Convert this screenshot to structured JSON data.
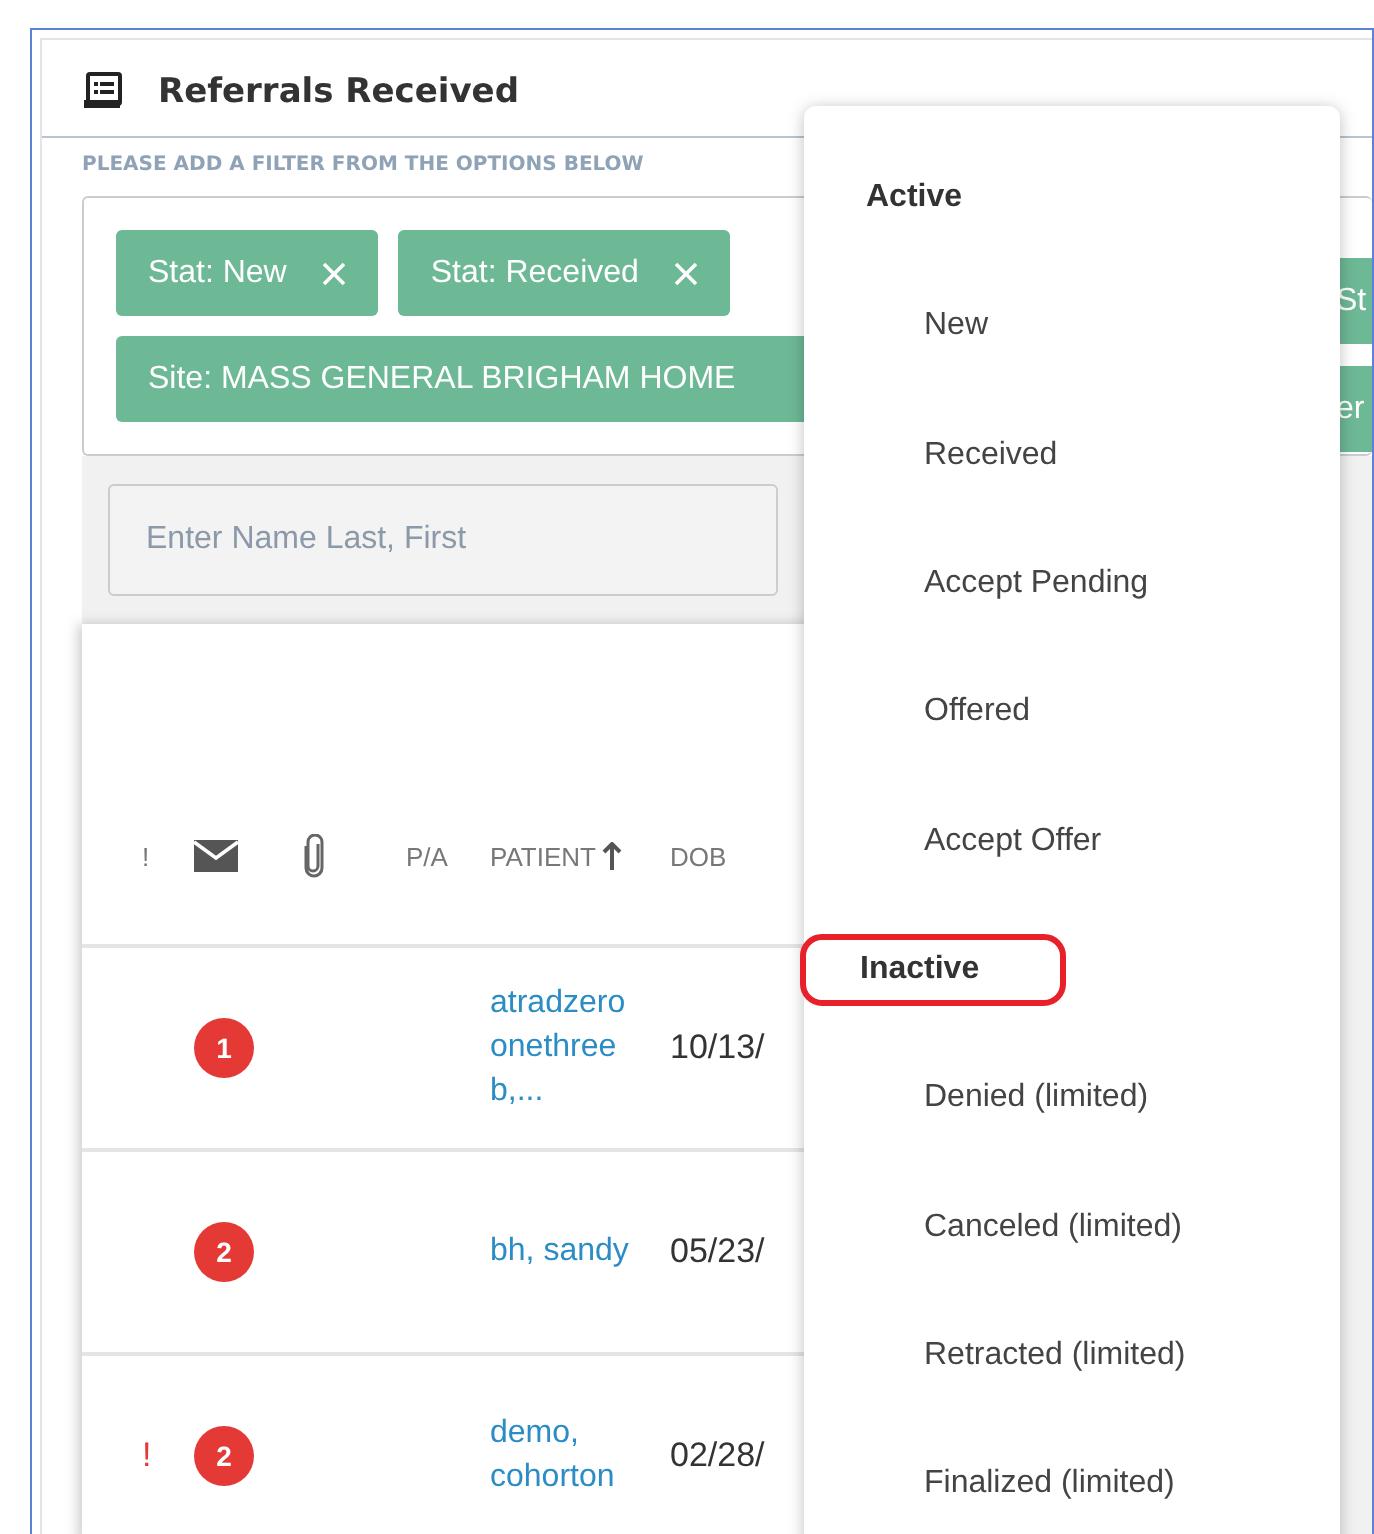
{
  "panel": {
    "title": "Referrals Received"
  },
  "filter": {
    "hint": "PLEASE ADD A FILTER FROM THE OPTIONS BELOW",
    "chips": [
      {
        "label": "Stat: New",
        "removable": true
      },
      {
        "label": "Stat: Received",
        "removable": true
      },
      {
        "label": "Site: MASS GENERAL BRIGHAM HOME",
        "removable": false
      }
    ],
    "cut_chips": [
      "St",
      "er"
    ],
    "name_field": {
      "placeholder": "Enter Name Last, First"
    }
  },
  "table": {
    "columns": [
      {
        "label": "!",
        "kind": "text"
      },
      {
        "kind": "mail"
      },
      {
        "kind": "clip"
      },
      {
        "label": "P/A",
        "kind": "text"
      },
      {
        "label": "PATIENT",
        "kind": "sorted"
      },
      {
        "label": "DOB",
        "kind": "text"
      }
    ],
    "rows": [
      {
        "count": "1",
        "patient": [
          "atradzero",
          "onethree",
          "b,..."
        ],
        "dob": "10/13/"
      },
      {
        "count": "2",
        "patient": [
          "bh, sandy"
        ],
        "dob": "05/23/"
      },
      {
        "flag": "!",
        "count": "2",
        "patient": [
          "demo,",
          "cohorton"
        ],
        "dob": "02/28/"
      }
    ]
  },
  "menu": {
    "items": [
      {
        "label": "Active",
        "kind": "group",
        "highlighted": false
      },
      {
        "label": "New",
        "kind": "option",
        "highlighted": false
      },
      {
        "label": "Received",
        "kind": "option",
        "highlighted": false
      },
      {
        "label": "Accept Pending",
        "kind": "option",
        "highlighted": false
      },
      {
        "label": "Offered",
        "kind": "option",
        "highlighted": false
      },
      {
        "label": "Accept Offer",
        "kind": "option",
        "highlighted": false
      },
      {
        "label": "Inactive",
        "kind": "group",
        "highlighted": true
      },
      {
        "label": "Denied (limited)",
        "kind": "option",
        "highlighted": false
      },
      {
        "label": "Canceled (limited)",
        "kind": "option",
        "highlighted": false
      },
      {
        "label": "Retracted (limited)",
        "kind": "option",
        "highlighted": false
      },
      {
        "label": "Finalized (limited)",
        "kind": "option",
        "highlighted": false
      }
    ]
  }
}
